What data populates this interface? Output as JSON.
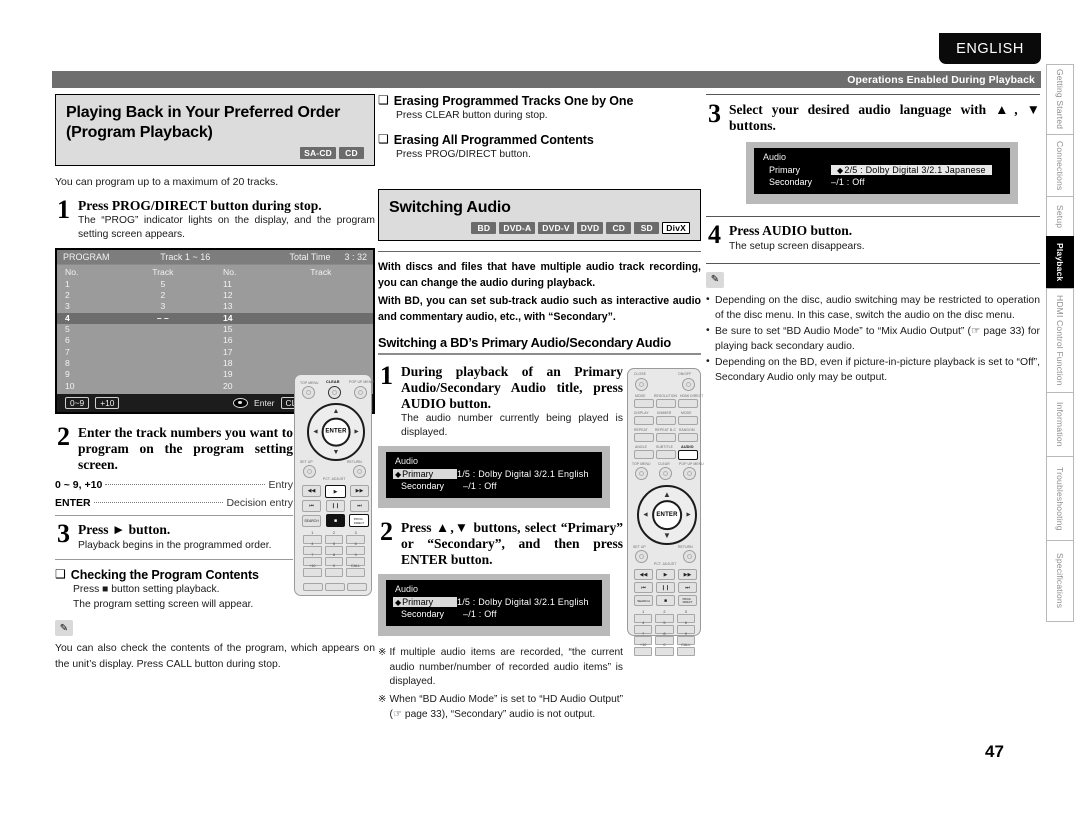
{
  "header": {
    "language_tab": "ENGLISH",
    "section_bar": "Operations Enabled During Playback",
    "page_number": "47"
  },
  "side_tabs": [
    {
      "label": "Getting Started",
      "active": false
    },
    {
      "label": "Connections",
      "active": false
    },
    {
      "label": "Setup",
      "active": false
    },
    {
      "label": "Playback",
      "active": true
    },
    {
      "label": "HDMI Control Function",
      "active": false
    },
    {
      "label": "Information",
      "active": false
    },
    {
      "label": "Troubleshooting",
      "active": false
    },
    {
      "label": "Specifications",
      "active": false
    }
  ],
  "left_column": {
    "section_title_line1": "Playing Back in Your Preferred Order",
    "section_title_line2": "(Program Playback)",
    "badges": [
      {
        "label": "SA-CD",
        "inverted": false
      },
      {
        "label": "CD",
        "inverted": false
      }
    ],
    "lead": "You can program up to a maximum of 20 tracks.",
    "step1": {
      "num": "1",
      "head": "Press PROG/DIRECT button during stop.",
      "sub": "The “PROG” indicator lights on the display, and the program setting screen appears."
    },
    "program_osd": {
      "title": "PROGRAM",
      "track_range": "Track 1 ~ 16",
      "total_time_label": "Total Time",
      "total_time_value": "3 : 32",
      "col_headers": [
        "No.",
        "Track",
        "No.",
        "Track"
      ],
      "rows": [
        {
          "no": "1",
          "track": "5",
          "no2": "11",
          "track2": "",
          "selected": false
        },
        {
          "no": "2",
          "track": "2",
          "no2": "12",
          "track2": "",
          "selected": false
        },
        {
          "no": "3",
          "track": "3",
          "no2": "13",
          "track2": "",
          "selected": false
        },
        {
          "no": "4",
          "track": "– –",
          "no2": "14",
          "track2": "",
          "selected": true
        },
        {
          "no": "5",
          "track": "",
          "no2": "15",
          "track2": "",
          "selected": false
        },
        {
          "no": "6",
          "track": "",
          "no2": "16",
          "track2": "",
          "selected": false
        },
        {
          "no": "7",
          "track": "",
          "no2": "17",
          "track2": "",
          "selected": false
        },
        {
          "no": "8",
          "track": "",
          "no2": "18",
          "track2": "",
          "selected": false
        },
        {
          "no": "9",
          "track": "",
          "no2": "19",
          "track2": "",
          "selected": false
        },
        {
          "no": "10",
          "track": "",
          "no2": "20",
          "track2": "",
          "selected": false
        }
      ],
      "footer": {
        "key_numeric": "0~9",
        "key_plus10": "+10",
        "enter_label": "Enter",
        "clear_key": "CLEAR",
        "clear_label": "Clear"
      }
    },
    "step2": {
      "num": "2",
      "head": "Enter the track numbers you want to program on the program setting screen.",
      "keys": [
        {
          "key": "0 ~ 9, +10",
          "value": "Entry"
        },
        {
          "key": "ENTER",
          "value": "Decision entry"
        }
      ]
    },
    "step3": {
      "num": "3",
      "head": "Press ► button.",
      "sub": "Playback begins in the programmed order."
    },
    "check_section": {
      "title": "Checking the Program Contents",
      "line1": "Press ■ button setting playback.",
      "line2": "The program setting screen will appear."
    },
    "note": {
      "icon": "pencil-icon",
      "text": "You can also check the contents of the program, which appears on the unit’s display. Press CALL button during stop."
    }
  },
  "middle_column": {
    "check1": {
      "title": "Erasing Programmed Tracks One by One",
      "sub": "Press CLEAR button during stop."
    },
    "check2": {
      "title": "Erasing All Programmed Contents",
      "sub": "Press PROG/DIRECT button."
    },
    "section_title": "Switching Audio",
    "badges": [
      {
        "label": "BD",
        "inverted": false
      },
      {
        "label": "DVD-A",
        "inverted": false
      },
      {
        "label": "DVD-V",
        "inverted": false
      },
      {
        "label": "DVD",
        "inverted": false
      },
      {
        "label": "CD",
        "inverted": false
      },
      {
        "label": "SD",
        "inverted": false
      },
      {
        "label": "DivX",
        "inverted": true
      }
    ],
    "intro1": "With discs and files that have multiple audio track recording, you can change the audio during playback.",
    "intro2": "With BD, you can set sub-track audio such as interactive audio and commentary audio, etc., with “Secondary”.",
    "subsection_title": "Switching a BD’s Primary Audio/Secondary Audio",
    "step1": {
      "num": "1",
      "head": "During playback of an Primary Audio/Secondary Audio title, press AUDIO button.",
      "sub": "The audio number currently being played is displayed."
    },
    "audio_osd_1": {
      "title": "Audio",
      "primary_label": "Primary",
      "primary_value": "1/5 : Dolby Digital  3/2.1   English",
      "secondary_label": "Secondary",
      "secondary_value": "–/1 : Off"
    },
    "step2": {
      "num": "2",
      "head": "Press ▲,▼ buttons, select “Primary” or “Secondary”, and then press ENTER button."
    },
    "audio_osd_2": {
      "title": "Audio",
      "primary_label": "Primary",
      "primary_value": "1/5 : Dolby Digital  3/2.1   English",
      "secondary_label": "Secondary",
      "secondary_value": "–/1 : Off"
    },
    "notes": [
      "If multiple audio items are recorded, “the current audio number/number of recorded audio items” is displayed.",
      "When “BD Audio Mode” is set to “HD Audio Output” (☞ page 33), “Secondary” audio is not output."
    ]
  },
  "right_column": {
    "step3": {
      "num": "3",
      "head": "Select your desired audio language with ▲, ▼ buttons."
    },
    "audio_osd_3": {
      "title": "Audio",
      "primary_label": "Primary",
      "primary_value": "2/5 : Dolby Digital  3/2.1   Japanese",
      "secondary_label": "Secondary",
      "secondary_value": "–/1 : Off"
    },
    "step4": {
      "num": "4",
      "head": "Press AUDIO button.",
      "sub": "The setup screen disappears."
    },
    "note_icon": "pencil-icon",
    "bullets": [
      "Depending on the disc, audio switching may be restricted to operation of the disc menu. In this case, switch the audio on the disc menu.",
      "Be sure to set “BD Audio Mode” to “Mix Audio Output” (☞ page 33) for playing back secondary audio.",
      "Depending on the BD, even if picture-in-picture playback is set to “Off”, Secondary Audio only may be output."
    ]
  },
  "remote_left": {
    "name": "remote-control-illustration-program",
    "labels": [
      "TOP MENU",
      "CLEAR",
      "POP UP MENU/MENU",
      "SET UP",
      "PCT. ADJUST",
      "RETURN",
      "SEARCH",
      "ENTER",
      "CALL",
      "+10"
    ],
    "numbers": [
      "1",
      "2",
      "3",
      "4",
      "5",
      "6",
      "7",
      "8",
      "9",
      "+10",
      "0",
      "CALL"
    ]
  },
  "remote_right": {
    "name": "remote-control-illustration-audio",
    "labels": [
      "CLOSE",
      "ON/OFF",
      "MODE",
      "RESOLUTION",
      "HDMI DIRECT",
      "DISPLAY",
      "DIMMER",
      "MODE",
      "REPEAT",
      "REPEAT B-C",
      "RANDOM",
      "ANGLE",
      "SUBTITLE",
      "AUDIO",
      "TOP MENU",
      "CLEAR",
      "POP UP MENU/MENU",
      "SET UP",
      "PCT. ADJUST",
      "RETURN",
      "ENTER"
    ],
    "numbers": [
      "1",
      "2",
      "3",
      "4",
      "5",
      "6",
      "7",
      "8",
      "9",
      "+10",
      "0",
      "CALL"
    ]
  }
}
